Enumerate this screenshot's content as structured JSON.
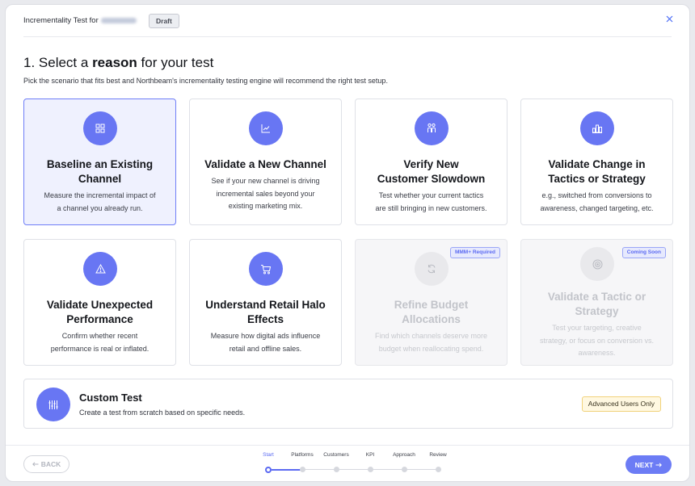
{
  "header": {
    "title": "Incrementality Test for",
    "status_badge": "Draft",
    "close_icon": "close-icon"
  },
  "intro": {
    "heading_prefix": "1. Select a",
    "heading_bold": "reason",
    "heading_suffix": "for your test",
    "subtitle": "Pick the scenario that fits best and Northbeam's incrementality testing engine will recommend the right test setup."
  },
  "cards": [
    {
      "icon": "grid-icon",
      "title_lines": [
        "Baseline an Existing",
        "Channel"
      ],
      "desc_lines": [
        "Measure the incremental impact of",
        "a channel you already run."
      ],
      "state": "selected"
    },
    {
      "icon": "line-chart-icon",
      "title_lines": [
        "Validate a New Channel"
      ],
      "desc_lines": [
        "See if your new channel is driving",
        "incremental sales beyond your",
        "existing marketing mix."
      ],
      "state": "default"
    },
    {
      "icon": "people-icon",
      "title_lines": [
        "Verify New",
        "Customer Slowdown"
      ],
      "desc_lines": [
        "Test whether your current tactics",
        "are still bringing in new customers."
      ],
      "state": "default"
    },
    {
      "icon": "strategy-icon",
      "title_lines": [
        "Validate Change in",
        "Tactics or Strategy"
      ],
      "desc_lines": [
        "e.g., switched from conversions to",
        "awareness, changed targeting, etc."
      ],
      "state": "default"
    },
    {
      "icon": "warning-icon",
      "title_lines": [
        "Validate Unexpected",
        "Performance"
      ],
      "desc_lines": [
        "Confirm whether recent",
        "performance is real or inflated."
      ],
      "state": "default"
    },
    {
      "icon": "cart-icon",
      "title_lines": [
        "Understand Retail Halo",
        "Effects"
      ],
      "desc_lines": [
        "Measure how digital ads influence",
        "retail and offline sales."
      ],
      "state": "default"
    },
    {
      "icon": "refresh-icon",
      "title_lines": [
        "Refine Budget",
        "Allocations"
      ],
      "desc_lines": [
        "Find which channels deserve more",
        "budget when reallocating spend."
      ],
      "state": "disabled",
      "badge": "MMM+ Required"
    },
    {
      "icon": "target-icon",
      "title_lines": [
        "Validate a Tactic or",
        "Strategy"
      ],
      "desc_lines": [
        "Test your targeting, creative",
        "strategy, or focus on conversion vs.",
        "awareness."
      ],
      "state": "disabled",
      "badge": "Coming Soon"
    }
  ],
  "custom_test": {
    "icon": "sliders-icon",
    "title": "Custom Test",
    "description": "Create a test from scratch based on specific needs.",
    "badge": "Advanced Users Only"
  },
  "footer": {
    "back_label": "BACK",
    "next_label": "NEXT",
    "steps": [
      "Start",
      "Platforms",
      "Customers",
      "KPI",
      "Approach",
      "Review"
    ],
    "current_step": "Start"
  },
  "colors": {
    "accent": "#6876f3",
    "selected_bg": "#eff1fe",
    "badge_yellow": "#fff8e1"
  }
}
